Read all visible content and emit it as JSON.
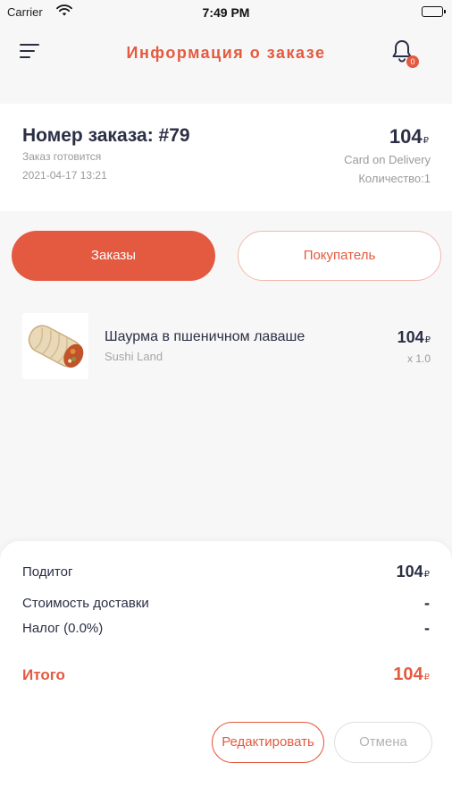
{
  "status_bar": {
    "carrier": "Carrier",
    "time": "7:49 PM"
  },
  "header": {
    "title": "Информация о заказе",
    "notification_count": "0"
  },
  "order": {
    "number": "Номер заказа: #79",
    "status": "Заказ готовится",
    "date": "2021-04-17 13:21",
    "amount": "104",
    "currency": "₽",
    "payment": "Card on Delivery",
    "quantity": "Количество:1"
  },
  "tabs": {
    "orders": "Заказы",
    "customer": "Покупатель"
  },
  "items": [
    {
      "name": "Шаурма в пшеничном лаваше",
      "shop": "Sushi Land",
      "price": "104",
      "currency": "₽",
      "qty": "x 1.0"
    }
  ],
  "summary": {
    "subtotal_label": "Подитог",
    "subtotal_value": "104",
    "delivery_label": "Стоимость доставки",
    "delivery_value": "-",
    "tax_label": "Налог (0.0%)",
    "tax_value": "-",
    "total_label": "Итого",
    "total_value": "104",
    "currency": "₽"
  },
  "actions": {
    "edit": "Редактировать",
    "cancel": "Отмена"
  },
  "colors": {
    "accent": "#e45a40",
    "text": "#2b2f45",
    "muted": "#9a9a9a",
    "background": "#f7f7f7"
  },
  "icons": [
    "menu-icon",
    "bell-icon",
    "wifi-icon",
    "battery-icon"
  ]
}
